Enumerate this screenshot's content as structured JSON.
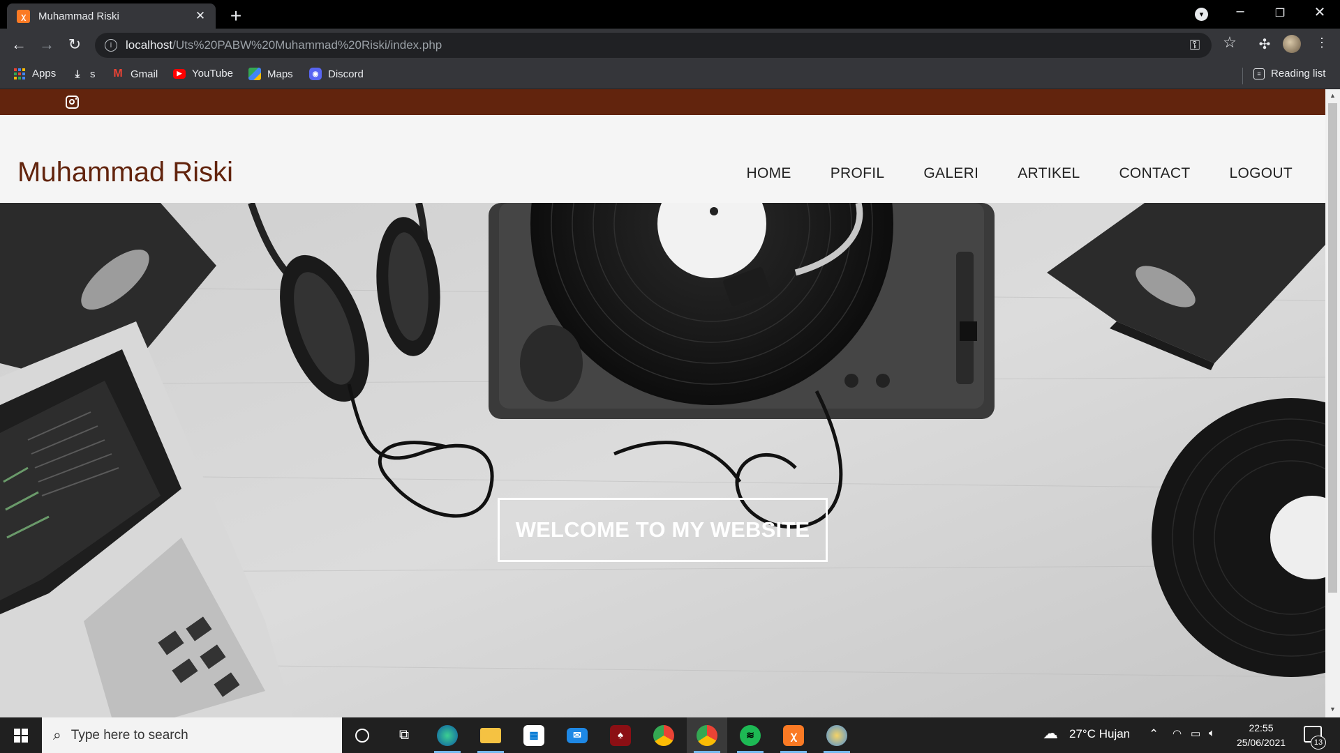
{
  "browser": {
    "tab_title": "Muhammad Riski",
    "tab_close": "✕",
    "new_tab": "+",
    "url_host": "localhost",
    "url_path": "/Uts%20PABW%20Muhammad%20Riski/index.php",
    "bookmarks": [
      "Apps",
      "s",
      "Gmail",
      "YouTube",
      "Maps",
      "Discord"
    ],
    "reading_list": "Reading list"
  },
  "site": {
    "brand": "Muhammad Riski",
    "nav": [
      "HOME",
      "PROFIL",
      "GALERI",
      "ARTIKEL",
      "CONTACT",
      "LOGOUT"
    ],
    "hero_text": "WELCOME TO MY WEBSITE",
    "colors": {
      "topbar": "#62240d",
      "brand": "#62240d"
    }
  },
  "taskbar": {
    "search_placeholder": "Type here to search",
    "weather": "27°C  Hujan",
    "time": "22:55",
    "date": "25/06/2021",
    "notification_count": "13"
  }
}
